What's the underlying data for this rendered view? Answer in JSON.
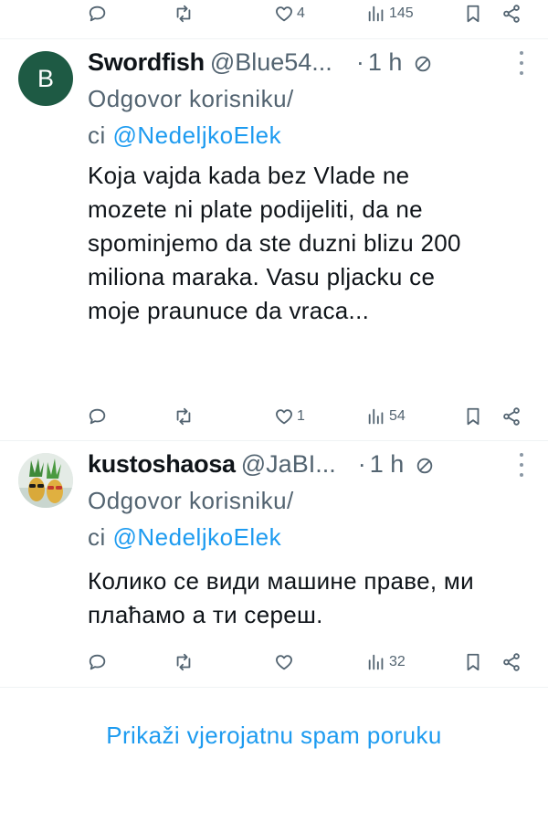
{
  "top_actions": {
    "reply_count": "",
    "repost_count": "",
    "like_count": "4",
    "view_count": "145"
  },
  "tweets": [
    {
      "avatar_letter": "B",
      "avatar_color": "#1e5a44",
      "display_name": "Swordfish",
      "handle": "@Blue54...",
      "dot": "·",
      "time": "1 h",
      "reply_prefix_line1": "Odgovor korisniku/",
      "reply_prefix_line2": "ci ",
      "reply_to": "@NedeljkoElek",
      "text": "Koja vajda kada bez Vlade ne mozete ni plate podijeliti, da ne spominjemo da ste duzni blizu 200 miliona maraka. Vasu pljacku ce moje praunuce da vraca...",
      "like_count": "1",
      "view_count": "54"
    },
    {
      "avatar_image": "pineapples-with-sunglasses",
      "display_name": "kustoshaosa",
      "handle": "@JaBI...",
      "dot": "·",
      "time": "1 h",
      "reply_prefix_line1": "Odgovor korisniku/",
      "reply_prefix_line2": "ci ",
      "reply_to": "@NedeljkoElek",
      "text": "Колико се види машине праве, ми плаћамо а ти сереш.",
      "like_count": "",
      "view_count": "32"
    }
  ],
  "spam_link": "Prikaži vjerojatnu spam poruku",
  "colors": {
    "link": "#1d9bf0",
    "secondary_text": "#536471",
    "primary_text": "#0f1419",
    "divider": "#eff3f4"
  },
  "icons": [
    "reply-icon",
    "repost-icon",
    "like-icon",
    "views-icon",
    "bookmark-icon",
    "share-icon",
    "restricted-reply-icon",
    "more-options-icon"
  ]
}
